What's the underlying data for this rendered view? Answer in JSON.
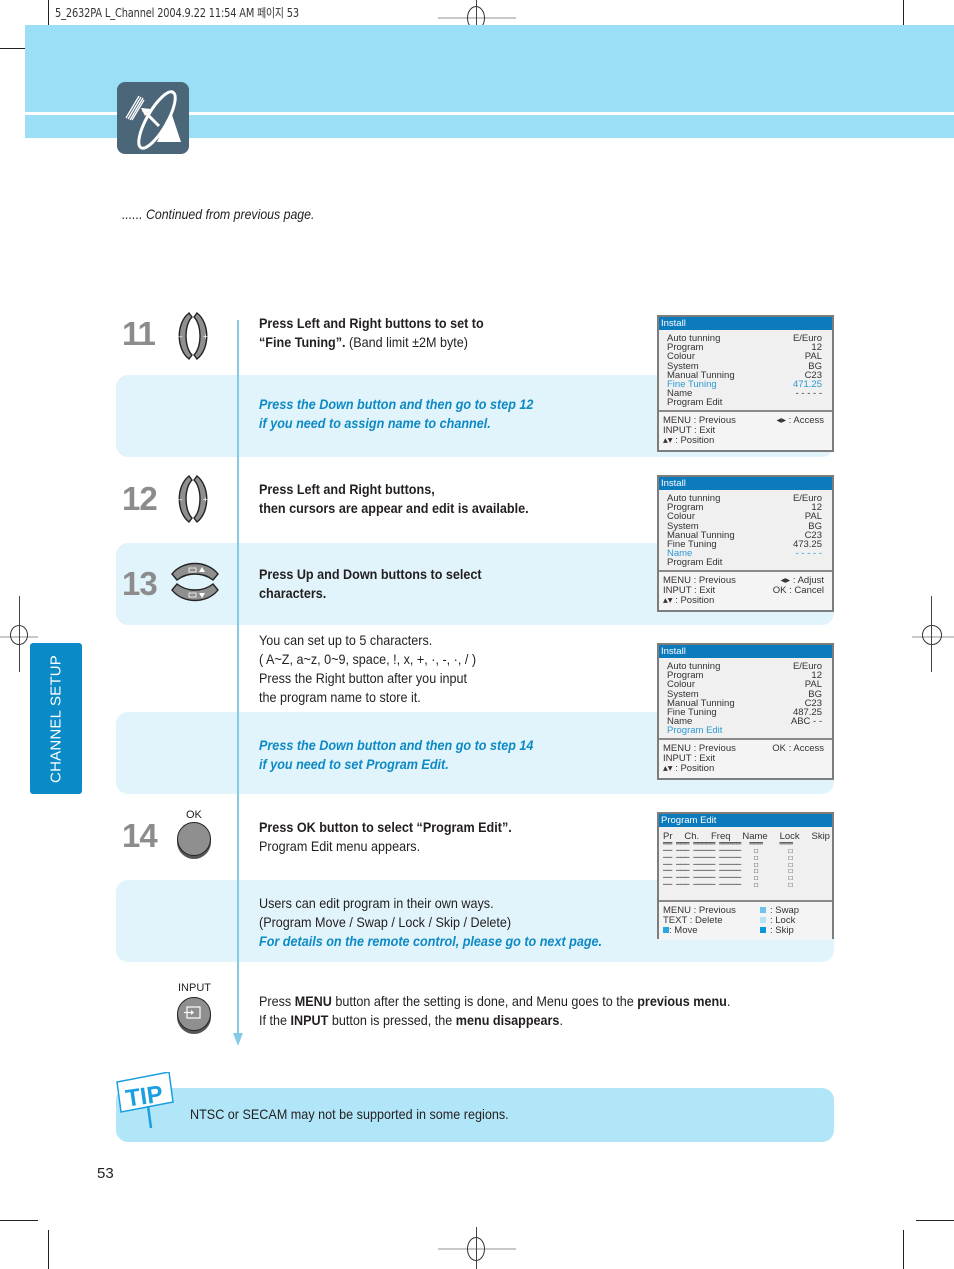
{
  "print_slug": "5_2632PA L_Channel  2004.9.22 11:54 AM 페이지 53",
  "header": {
    "logo_icon": "satellite-dish-icon"
  },
  "continued_note": "...... Continued from previous page.",
  "side_tab": {
    "label": "CHANNEL SETUP"
  },
  "steps": [
    {
      "number": "11",
      "button_icon": "left-right-buttons-icon",
      "instruction_bold": "Press Left and Right buttons to set to",
      "instruction_bold_2": "“Fine Tuning”.",
      "instruction_plain": " (Band limit ±2M byte)",
      "note_line1": "Press the Down button and then go to step 12",
      "note_line2": "if you need to assign name to channel."
    },
    {
      "number": "12",
      "button_icon": "left-right-buttons-icon",
      "instruction_line1": "Press Left and Right buttons,",
      "instruction_line2": "then cursors are appear and edit is available."
    },
    {
      "number": "13",
      "button_icon": "up-down-buttons-icon",
      "instruction_line1": "Press Up and Down buttons to select",
      "instruction_line2": "characters.",
      "detail_line1": "You can set up to 5 characters.",
      "detail_line2": "( A~Z,  a~z,  0~9,  space,  !,  x,  +,  ·,  -,  ·,  / )",
      "detail_line3": "Press the Right button after you input",
      "detail_line4": "the program name to store it.",
      "note_line1": "Press the Down button and then go to step 14",
      "note_line2": "if you need to set Program Edit."
    },
    {
      "number": "14",
      "button_label": "OK",
      "button_icon": "ok-button-icon",
      "instruction_bold": "Press OK button to select  “Program Edit”.",
      "instruction_line2": "Program Edit menu appears.",
      "detail_line1": "Users can edit program in their own ways.",
      "detail_line2": "(Program Move / Swap / Lock / Skip / Delete)",
      "note": "For details on the remote control, please go to next page."
    }
  ],
  "input_step": {
    "button_label": "INPUT",
    "button_icon": "input-source-icon",
    "line1_a": "Press ",
    "line1_b": "MENU",
    "line1_c": " button after the setting is done, and Menu goes to the ",
    "line1_d": "previous menu",
    "line1_e": ".",
    "line2_a": "If the ",
    "line2_b": "INPUT",
    "line2_c": " button is pressed, the ",
    "line2_d": "menu disappears",
    "line2_e": "."
  },
  "osd_screens": [
    {
      "title": "Install",
      "rows": [
        {
          "label": "Auto tunning",
          "value": "E/Euro"
        },
        {
          "label": "Program",
          "value": "12"
        },
        {
          "label": "Colour",
          "value": "PAL"
        },
        {
          "label": "System",
          "value": "BG"
        },
        {
          "label": "Manual Tunning",
          "value": "C23"
        },
        {
          "label": "Fine Tuning",
          "value": "471.25",
          "highlight": true
        },
        {
          "label": "Name",
          "value": "- - - - -"
        },
        {
          "label": "Program Edit",
          "value": ""
        }
      ],
      "footer": [
        {
          "left": "MENU : Previous",
          "right": "◂▸ : Access"
        },
        {
          "left": "INPUT : Exit",
          "right": ""
        },
        {
          "left": "▴▾ : Position",
          "right": ""
        }
      ]
    },
    {
      "title": "Install",
      "rows": [
        {
          "label": "Auto tunning",
          "value": "E/Euro"
        },
        {
          "label": "Program",
          "value": "12"
        },
        {
          "label": "Colour",
          "value": "PAL"
        },
        {
          "label": "System",
          "value": "BG"
        },
        {
          "label": "Manual Tunning",
          "value": "C23"
        },
        {
          "label": "Fine Tuning",
          "value": "473.25"
        },
        {
          "label": "Name",
          "value": "- - - - -",
          "highlight": true
        },
        {
          "label": "Program Edit",
          "value": ""
        }
      ],
      "footer": [
        {
          "left": "MENU : Previous",
          "right": "◂▸ : Adjust"
        },
        {
          "left": "INPUT : Exit",
          "right": "OK : Cancel"
        },
        {
          "left": "▴▾ : Position",
          "right": ""
        }
      ]
    },
    {
      "title": "Install",
      "rows": [
        {
          "label": "Auto tunning",
          "value": "E/Euro"
        },
        {
          "label": "Program",
          "value": "12"
        },
        {
          "label": "Colour",
          "value": "PAL"
        },
        {
          "label": "System",
          "value": "BG"
        },
        {
          "label": "Manual Tunning",
          "value": "C23"
        },
        {
          "label": "Fine Tuning",
          "value": "487.25"
        },
        {
          "label": "Name",
          "value": "ABC - -"
        },
        {
          "label": "Program Edit",
          "value": "",
          "highlight": true
        }
      ],
      "footer": [
        {
          "left": "MENU : Previous",
          "right": "OK : Access"
        },
        {
          "left": "INPUT : Exit",
          "right": ""
        },
        {
          "left": "▴▾ : Position",
          "right": ""
        }
      ]
    }
  ],
  "program_edit_screen": {
    "title": "Program Edit",
    "columns": [
      "Pr",
      "Ch.",
      "Freq",
      "Name",
      "Lock",
      "Skip"
    ],
    "row_count": 6,
    "footer": [
      {
        "left": "MENU : Previous",
        "right": ": Swap",
        "right_color": "#6cc4ec"
      },
      {
        "left": "TEXT   : Delete",
        "right": ": Lock",
        "right_color": "#b6e4f7"
      },
      {
        "left": ": Move",
        "left_color": "#2aa6e0",
        "right": ": Skip",
        "right_color": "#0a96d8"
      }
    ]
  },
  "tip": {
    "badge": "TIP",
    "text": "NTSC or SECAM may not be supported in some regions."
  },
  "page_number": "53",
  "colors": {
    "accent": "#0d8ac4",
    "band": "#9adff5",
    "panel": "#e1f3fb",
    "osd_title": "#0c7bbd"
  }
}
